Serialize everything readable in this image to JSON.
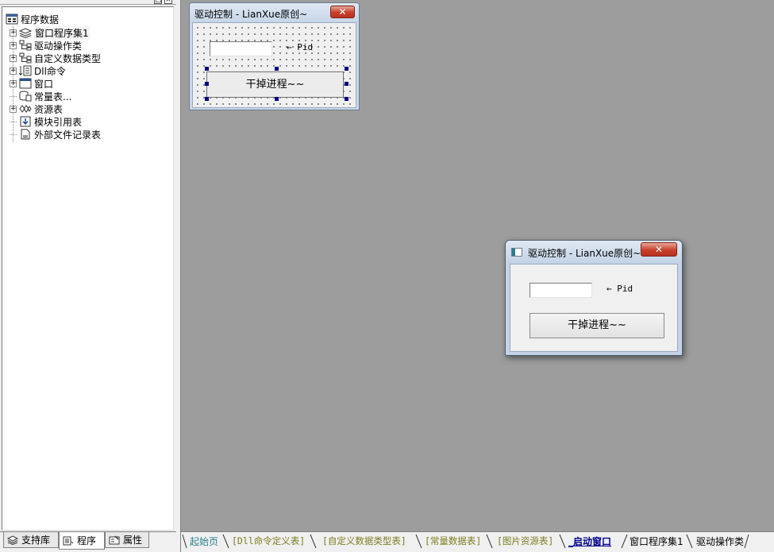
{
  "left_panel": {
    "tree": {
      "root": "程序数据",
      "items": [
        {
          "label": "窗口程序集1",
          "expandable": true
        },
        {
          "label": "驱动操作类",
          "expandable": true
        },
        {
          "label": "自定义数据类型",
          "expandable": true
        },
        {
          "label": "Dll命令",
          "expandable": true
        },
        {
          "label": "窗口",
          "expandable": true
        },
        {
          "label": "常量表...",
          "expandable": false
        },
        {
          "label": "资源表",
          "expandable": true
        },
        {
          "label": "模块引用表",
          "expandable": false
        },
        {
          "label": "外部文件记录表",
          "expandable": false
        }
      ]
    },
    "tabs": [
      {
        "label": "支持库",
        "icon": "stack-icon"
      },
      {
        "label": "程序",
        "icon": "document-icon",
        "active": true
      },
      {
        "label": "属性",
        "icon": "properties-icon"
      }
    ]
  },
  "design_window": {
    "title": "驱动控制 - LianXue原创~",
    "close_label": "✕",
    "pid_label": "← Pid",
    "button_label": "干掉进程~~"
  },
  "run_window": {
    "title": "驱动控制 - LianXue原创~",
    "close_label": "✕",
    "pid_label": "← Pid",
    "button_label": "干掉进程~~",
    "pid_value": ""
  },
  "bottom_tabs": [
    {
      "label": "起始页",
      "style": "teal"
    },
    {
      "label": "[Dll命令定义表]",
      "style": "yellowish"
    },
    {
      "label": "[自定义数据类型表]",
      "style": "yellowish"
    },
    {
      "label": "[常量数据表]",
      "style": "yellowish"
    },
    {
      "label": "[图片资源表]",
      "style": "yellowish"
    },
    {
      "label": "_启动窗口",
      "style": "active"
    },
    {
      "label": "窗口程序集1",
      "style": "black"
    },
    {
      "label": "驱动操作类",
      "style": "black"
    }
  ],
  "colors": {
    "workspace": "#9d9d9d",
    "panel": "#f0f0f0",
    "close_red": "#c8402c",
    "active_tab": "#00008b",
    "table_tab": "#7d7d22",
    "start_tab": "#2b7f8f"
  }
}
